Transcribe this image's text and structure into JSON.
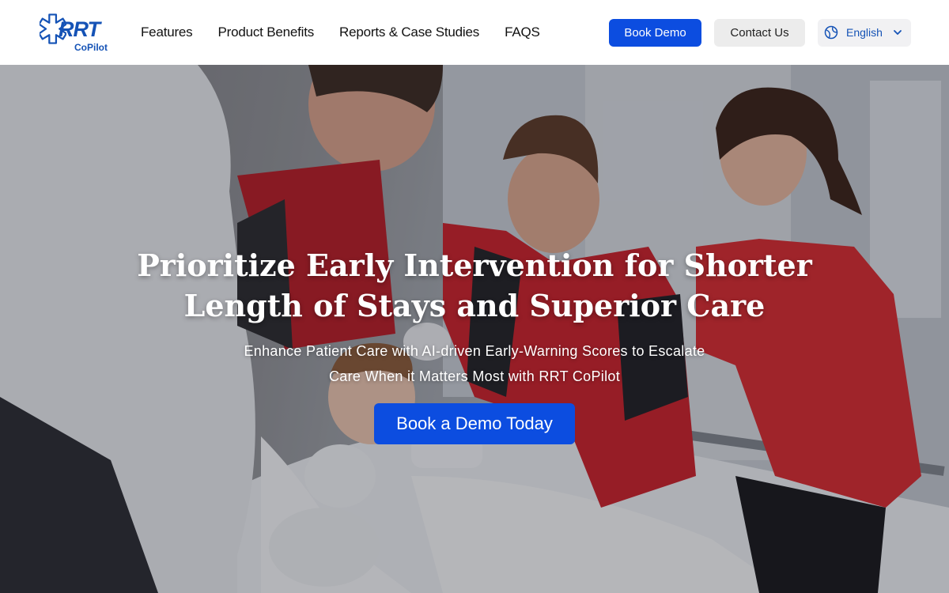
{
  "header": {
    "logo": {
      "mark": "RRT",
      "sub": "CoPilot"
    },
    "nav": [
      {
        "label": "Features"
      },
      {
        "label": "Product Benefits"
      },
      {
        "label": "Reports & Case Studies"
      },
      {
        "label": "FAQS"
      }
    ],
    "book_demo_label": "Book Demo",
    "contact_label": "Contact Us",
    "language": {
      "icon": "globe-icon",
      "selected": "English",
      "chevron": "chevron-down-icon"
    }
  },
  "hero": {
    "title_line1": "Prioritize Early Intervention for Shorter",
    "title_line2": "Length of Stays and Superior Care",
    "subtitle_line1": "Enhance Patient Care with AI-driven Early-Warning Scores to Escalate",
    "subtitle_line2": "Care When it Matters Most with RRT CoPilot",
    "cta_label": "Book a Demo Today",
    "background_image": "medical-team-attending-child-patient-photo"
  },
  "colors": {
    "brand_blue": "#1553b6",
    "primary_button": "#0c4de0",
    "secondary_button": "#ececec",
    "nav_text": "#111111",
    "hero_text": "#ffffff",
    "uniform_red": "#c8202a"
  }
}
